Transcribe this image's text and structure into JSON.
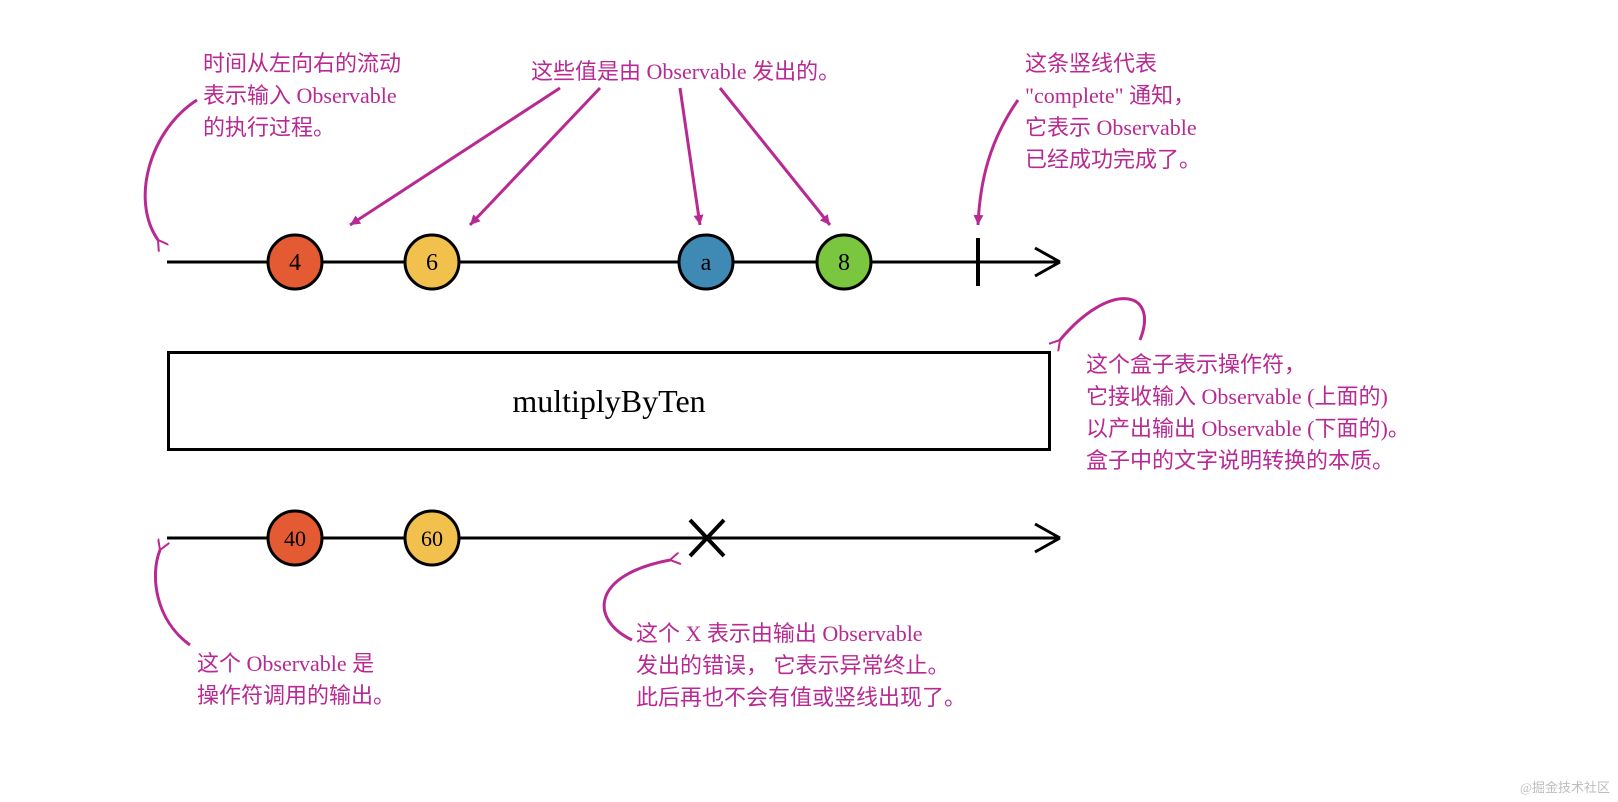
{
  "annotations": {
    "timeFlow": "时间从左向右的流动\n表示输入 Observable\n的执行过程。",
    "emitted": "这些值是由 Observable 发出的。",
    "complete": "这条竖线代表\n\"complete\" 通知，\n它表示 Observable\n已经成功完成了。",
    "operatorBox": "这个盒子表示操作符，\n它接收输入 Observable (上面的)\n以产出输出 Observable (下面的)。\n盒子中的文字说明转换的本质。",
    "output": "这个 Observable 是\n操作符调用的输出。",
    "error": "这个 X 表示由输出 Observable\n发出的错误， 它表示异常终止。\n此后再也不会有值或竖线出现了。"
  },
  "operator": {
    "label": "multiplyByTen"
  },
  "marbles": {
    "input": [
      {
        "label": "4",
        "color": "#e45a33"
      },
      {
        "label": "6",
        "color": "#f1c04d"
      },
      {
        "label": "a",
        "color": "#3f89b5"
      },
      {
        "label": "8",
        "color": "#7ac63f"
      }
    ],
    "output": [
      {
        "label": "40",
        "color": "#e45a33"
      },
      {
        "label": "60",
        "color": "#f1c04d"
      }
    ]
  },
  "watermark": "@掘金技术社区"
}
